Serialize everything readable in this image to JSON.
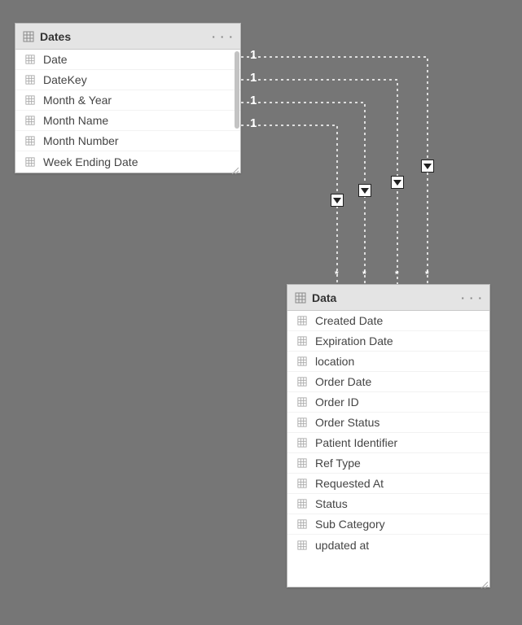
{
  "tables": {
    "dates": {
      "title": "Dates",
      "fields": [
        "Date",
        "DateKey",
        "Month & Year",
        "Month Name",
        "Month Number",
        "Week Ending Date"
      ]
    },
    "data": {
      "title": "Data",
      "fields": [
        "Created Date",
        "Expiration Date",
        "location",
        "Order Date",
        "Order ID",
        "Order Status",
        "Patient Identifier",
        "Ref Type",
        "Requested At",
        "Status",
        "Sub Category",
        "updated at"
      ]
    }
  },
  "relationships": {
    "from_cardinality": "1",
    "to_cardinality": "*",
    "count": 4
  }
}
